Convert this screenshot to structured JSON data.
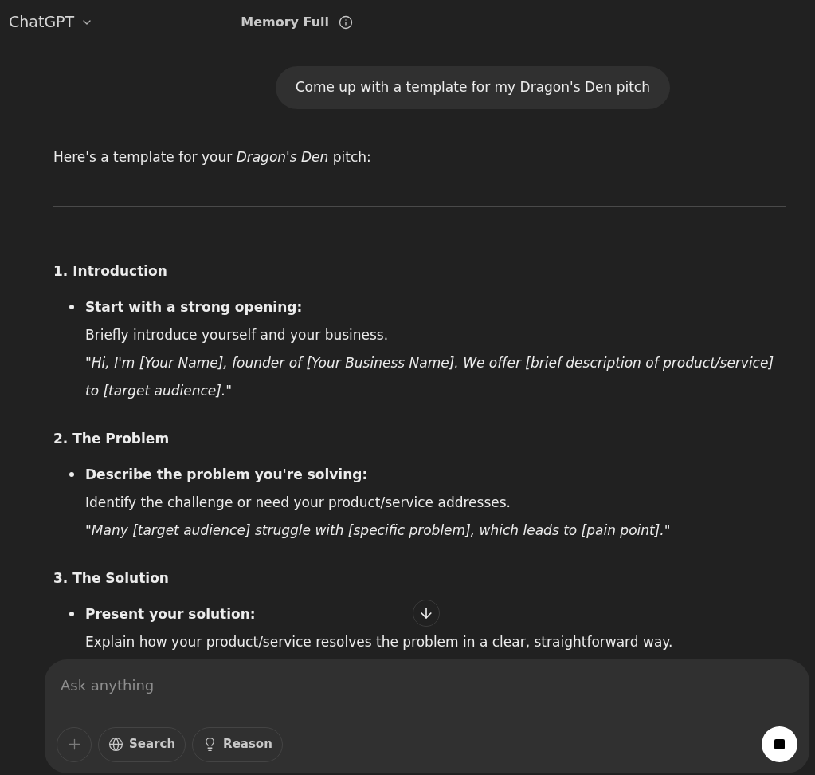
{
  "header": {
    "model": "ChatGPT",
    "memory_status": "Memory Full"
  },
  "user_message": "Come up with a template for my Dragon's Den pitch",
  "reply": {
    "intro": "Here's a template for your *Dragon's Den* pitch:",
    "sections": [
      {
        "heading": "1. Introduction",
        "bullets": [
          {
            "title": "Start with a strong opening:",
            "lines": [
              {
                "kind": "plain",
                "text": "Briefly introduce yourself and your business."
              },
              {
                "kind": "quote",
                "text": "\"Hi, I'm [Your Name], founder of [Your Business Name]. We offer [brief description of product/service] to [target audience].\""
              }
            ]
          }
        ]
      },
      {
        "heading": "2. The Problem",
        "bullets": [
          {
            "title": "Describe the problem you're solving:",
            "lines": [
              {
                "kind": "plain",
                "text": "Identify the challenge or need your product/service addresses."
              },
              {
                "kind": "quote",
                "text": "\"Many [target audience] struggle with [specific problem], which leads to [pain point].\""
              }
            ]
          }
        ]
      },
      {
        "heading": "3. The Solution",
        "bullets": [
          {
            "title": "Present your solution:",
            "lines": [
              {
                "kind": "plain",
                "text": "Explain how your product/service resolves the problem in a clear, straightforward way."
              }
            ]
          }
        ]
      }
    ]
  },
  "composer": {
    "placeholder": "Ask anything",
    "tools": [
      {
        "kind": "search",
        "label": "Search"
      },
      {
        "kind": "reason",
        "label": "Reason"
      }
    ]
  }
}
